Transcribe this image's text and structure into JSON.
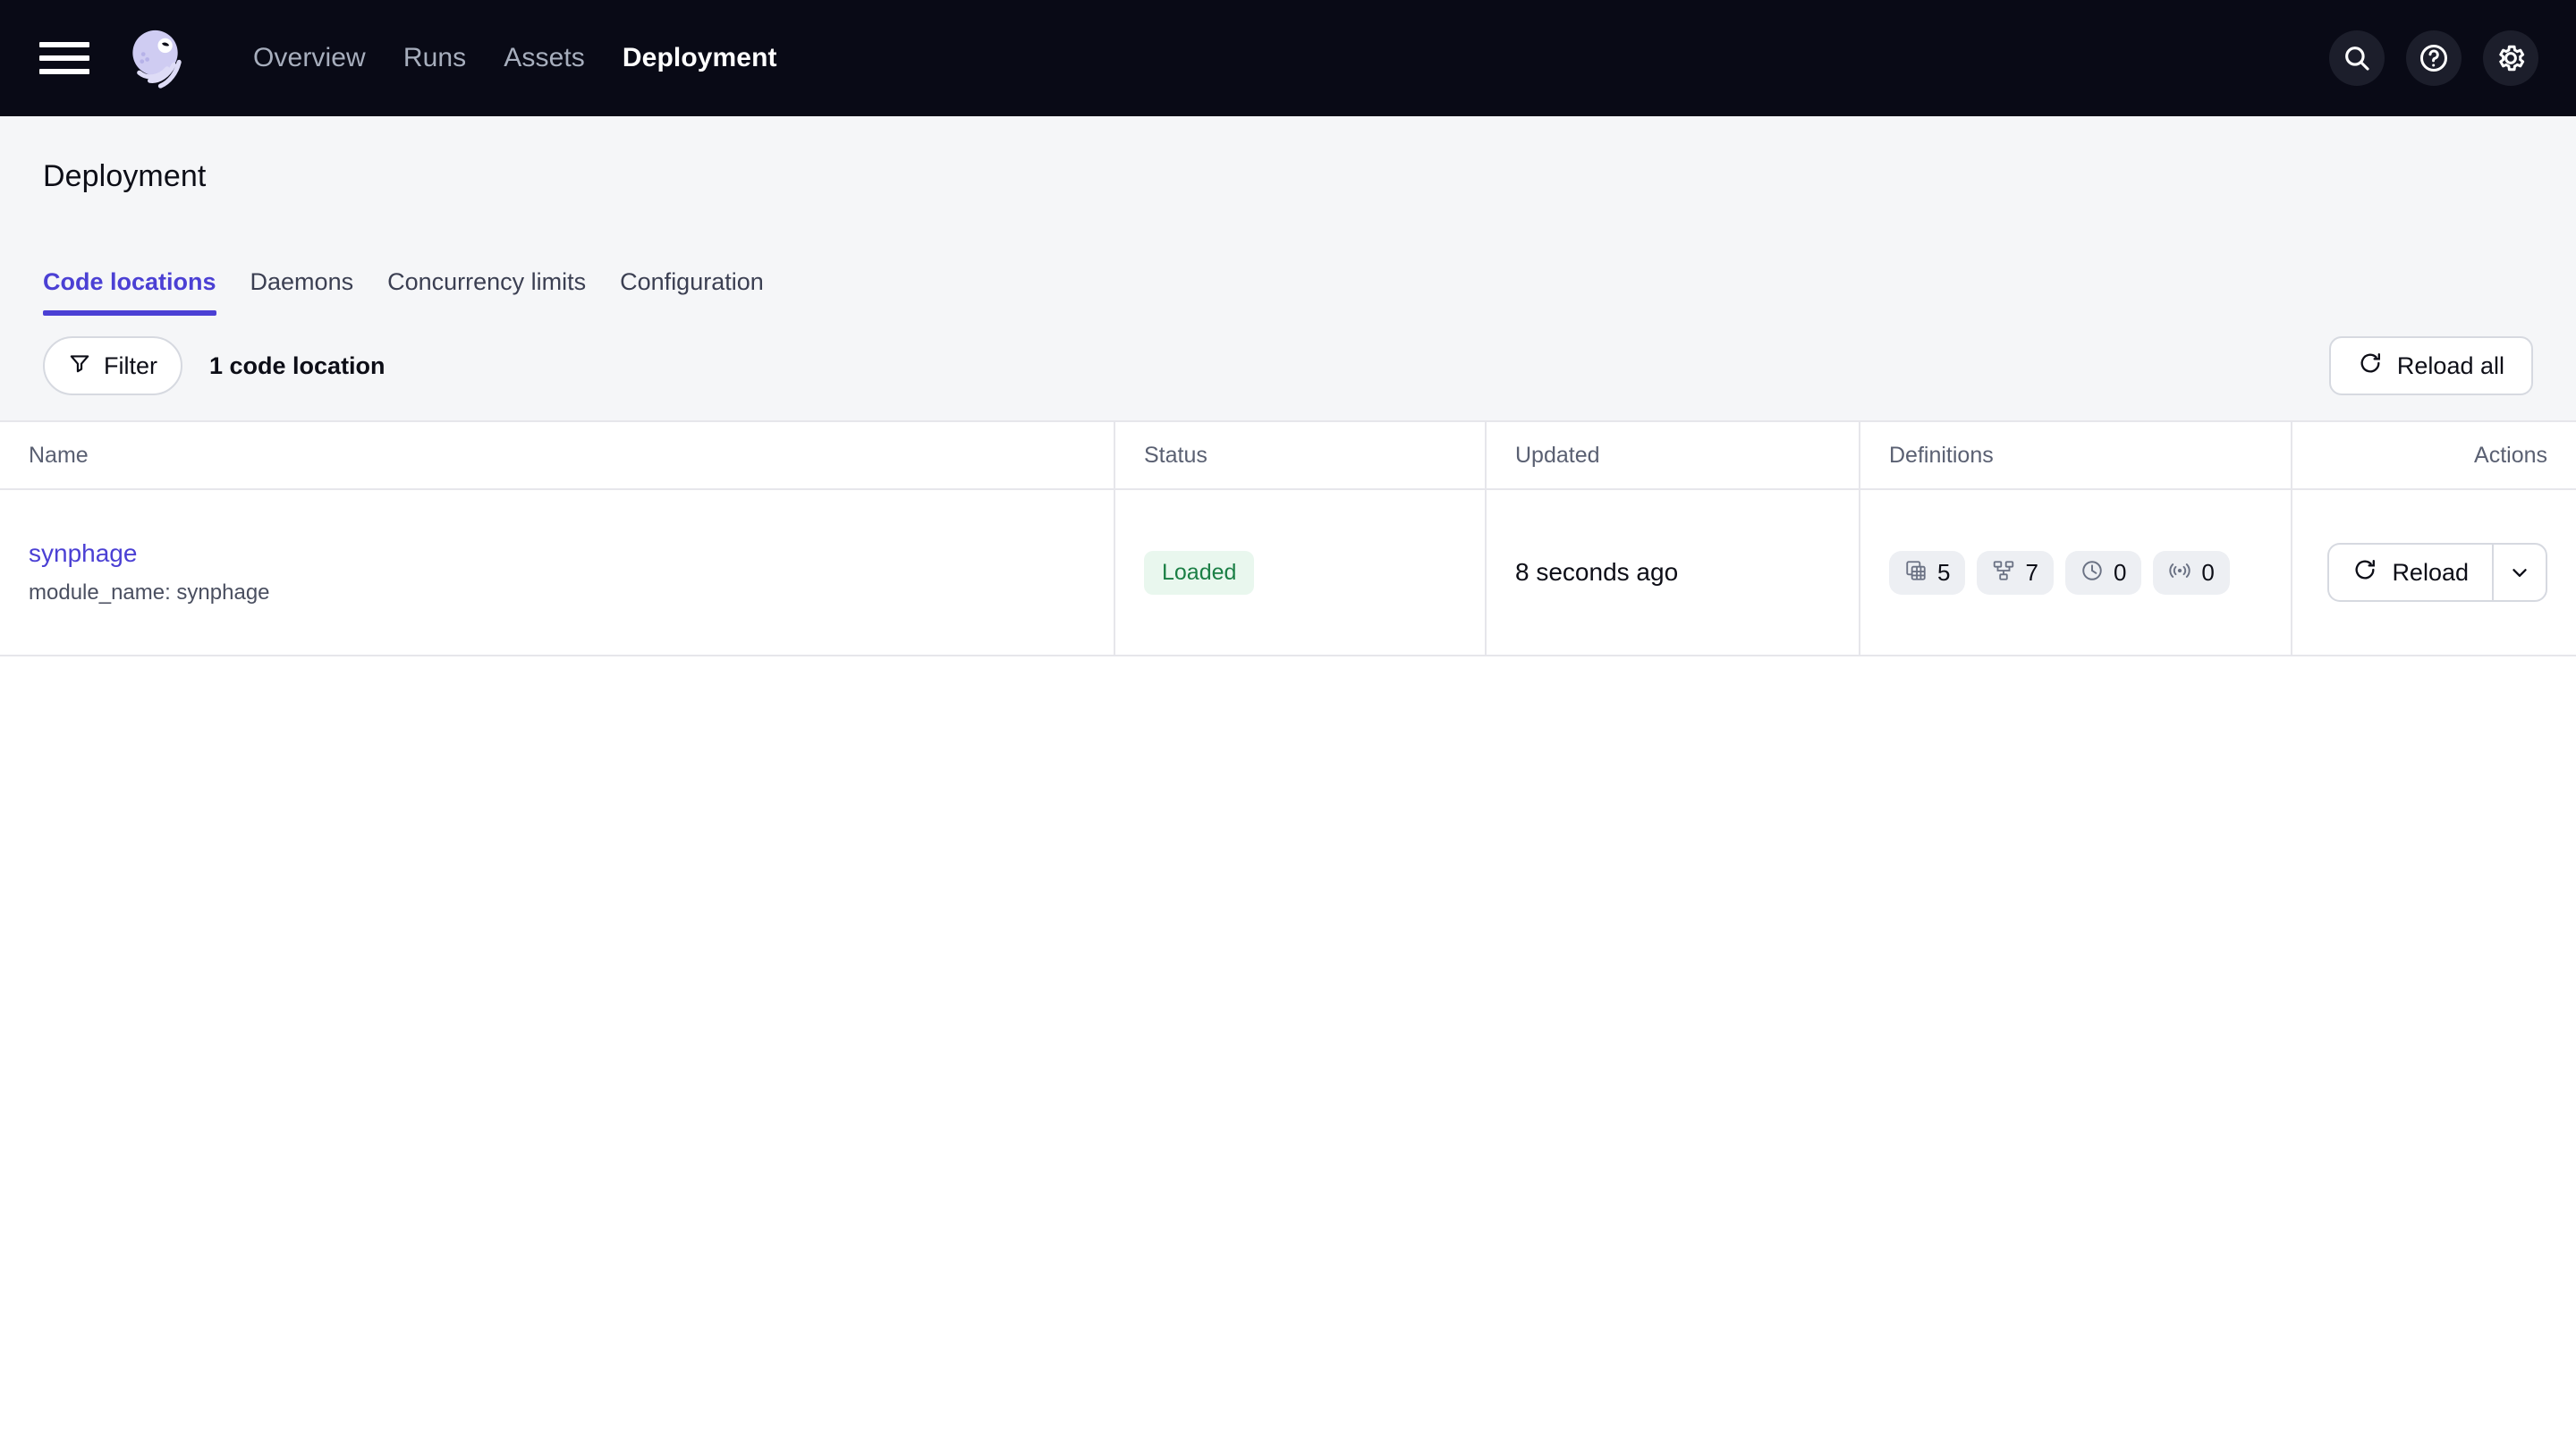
{
  "nav": {
    "menu_icon": "hamburger-menu-icon",
    "logo_icon": "dagster-jellyfish-logo",
    "links": [
      {
        "label": "Overview",
        "active": false
      },
      {
        "label": "Runs",
        "active": false
      },
      {
        "label": "Assets",
        "active": false
      },
      {
        "label": "Deployment",
        "active": true
      }
    ],
    "actions": [
      {
        "icon": "search-icon"
      },
      {
        "icon": "help-icon"
      },
      {
        "icon": "gear-icon"
      }
    ]
  },
  "header": {
    "title": "Deployment",
    "tabs": [
      {
        "label": "Code locations",
        "active": true
      },
      {
        "label": "Daemons",
        "active": false
      },
      {
        "label": "Concurrency limits",
        "active": false
      },
      {
        "label": "Configuration",
        "active": false
      }
    ]
  },
  "toolbar": {
    "filter_label": "Filter",
    "filter_icon": "funnel-icon",
    "count_label": "1 code location",
    "reload_all_label": "Reload all",
    "reload_all_icon": "refresh-icon"
  },
  "table": {
    "columns": [
      "Name",
      "Status",
      "Updated",
      "Definitions",
      "Actions"
    ],
    "rows": [
      {
        "name": "synphage",
        "subtitle": "module_name: synphage",
        "status": "Loaded",
        "updated": "8 seconds ago",
        "definitions": [
          {
            "icon": "assets-icon",
            "value": "5"
          },
          {
            "icon": "jobs-icon",
            "value": "7"
          },
          {
            "icon": "schedules-clock-icon",
            "value": "0"
          },
          {
            "icon": "sensors-icon",
            "value": "0"
          }
        ],
        "action_label": "Reload",
        "action_icon": "refresh-icon",
        "action_caret_icon": "chevron-down-icon"
      }
    ]
  },
  "colors": {
    "nav_background": "#090A16",
    "header_background": "#F5F6F8",
    "accent": "#4B40D4",
    "status_loaded_text": "#1B7F45",
    "status_loaded_bg": "#E9F7EE",
    "border": "#E6E6EB",
    "logo": "#CFCCF2"
  }
}
